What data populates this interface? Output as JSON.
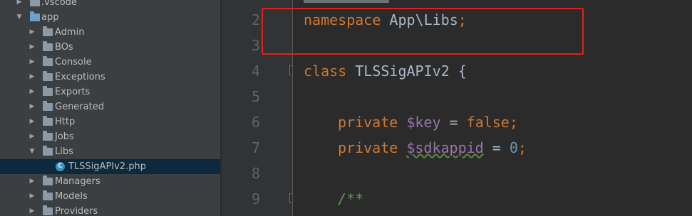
{
  "project_tree": {
    "items": [
      {
        "label": ".vscode",
        "expanded": false,
        "selected": false
      },
      {
        "label": "app",
        "expanded": true,
        "selected": false
      },
      {
        "label": "Admin",
        "expanded": false,
        "selected": false
      },
      {
        "label": "BOs",
        "expanded": false,
        "selected": false
      },
      {
        "label": "Console",
        "expanded": false,
        "selected": false
      },
      {
        "label": "Exceptions",
        "expanded": false,
        "selected": false
      },
      {
        "label": "Exports",
        "expanded": false,
        "selected": false
      },
      {
        "label": "Generated",
        "expanded": false,
        "selected": false
      },
      {
        "label": "Http",
        "expanded": false,
        "selected": false
      },
      {
        "label": "Jobs",
        "expanded": false,
        "selected": false
      },
      {
        "label": "Libs",
        "expanded": true,
        "selected": false
      },
      {
        "label": "TLSSigAPIv2.php",
        "expanded": false,
        "selected": true,
        "file_icon": "C"
      },
      {
        "label": "Managers",
        "expanded": false,
        "selected": false
      },
      {
        "label": "Models",
        "expanded": false,
        "selected": false
      },
      {
        "label": "Providers",
        "expanded": false,
        "selected": false
      }
    ]
  },
  "editor": {
    "line_numbers": [
      "2",
      "3",
      "4",
      "5",
      "6",
      "7",
      "8",
      "9"
    ],
    "lines": {
      "l2_kw": "namespace",
      "l2_rest": " App\\Libs",
      "l2_semi": ";",
      "l4_kw": "class",
      "l4_rest": " TLSSigAPIv2 {",
      "l6_kw": "private",
      "l6_sp": " ",
      "l6_var": "$key",
      "l6_eq": " = ",
      "l6_val": "false",
      "l6_semi": ";",
      "l7_kw": "private",
      "l7_sp": " ",
      "l7_var": "$sdkappid",
      "l7_eq": " = ",
      "l7_val": "0",
      "l7_semi": ";",
      "l9_cmt": "/**"
    }
  },
  "colors": {
    "keyword": "#cc7832",
    "variable": "#9876aa",
    "number": "#6897bb",
    "comment": "#629755",
    "text": "#a9b7c6",
    "highlight": "#e02020"
  }
}
